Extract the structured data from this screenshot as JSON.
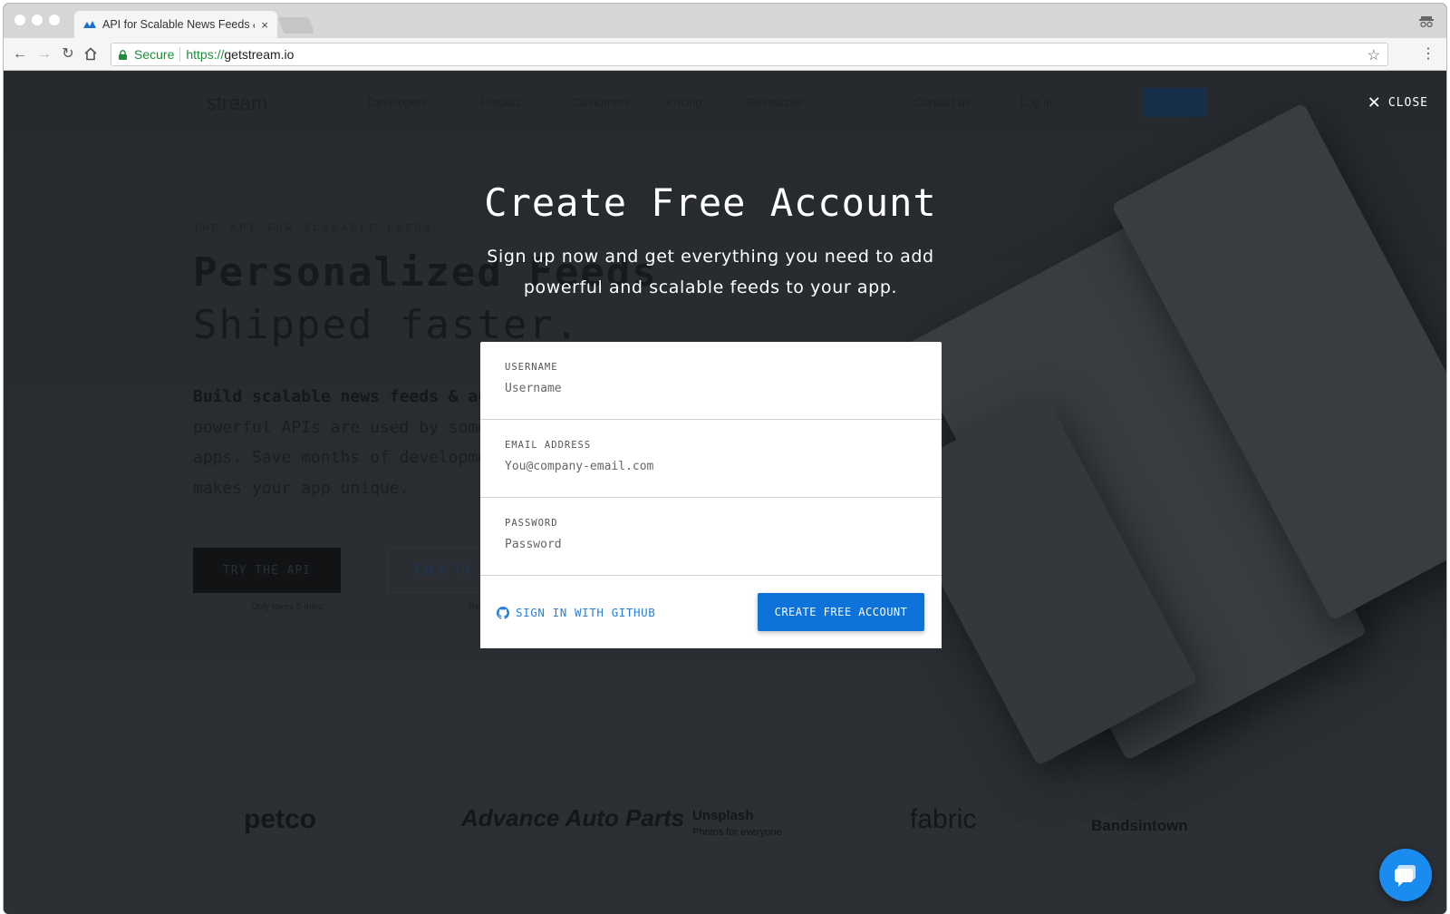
{
  "browser": {
    "tab_title": "API for Scalable News Feeds &",
    "tab_close": "×",
    "secure_label": "Secure",
    "url_scheme": "https://",
    "url_host": "getstream.io"
  },
  "background_page": {
    "logo": "stream",
    "nav": [
      "Developers",
      "Product",
      "Customers",
      "Pricing",
      "Resources",
      "Contact us",
      "Log in"
    ],
    "eyebrow": "THE API FOR SCALABLE FEEDS",
    "headline_bold": "Personalized Feeds",
    "headline_light": "Shipped faster.",
    "paragraph_lead": "Build scalable news feeds & activ",
    "paragraph_rest": [
      "powerful APIs are used by some",
      "apps. Save months of developme",
      "makes your app unique."
    ],
    "try_api": "TRY THE API",
    "try_api_note": "Only takes 5 mins!",
    "talk_btn": "TALK TO AN",
    "talk_note": "Re",
    "logos": [
      "petco",
      "Advance Auto Parts",
      "Unsplash",
      "fabric",
      "Bandsintown"
    ],
    "unsplash_tagline": "Photos for everyone"
  },
  "modal": {
    "close_label": "CLOSE",
    "title": "Create Free Account",
    "subtitle": "Sign up now and get everything you need to add powerful and scalable feeds to your app.",
    "fields": [
      {
        "label": "USERNAME",
        "placeholder": "Username"
      },
      {
        "label": "EMAIL ADDRESS",
        "placeholder": "You@company-email.com"
      },
      {
        "label": "PASSWORD",
        "placeholder": "Password"
      }
    ],
    "github_link": "SIGN IN WITH GITHUB",
    "submit": "CREATE FREE ACCOUNT"
  },
  "colors": {
    "accent": "#0e72db",
    "link": "#2a7fd8",
    "overlay": "#2b2f33",
    "secure_green": "#1e8c3a"
  }
}
